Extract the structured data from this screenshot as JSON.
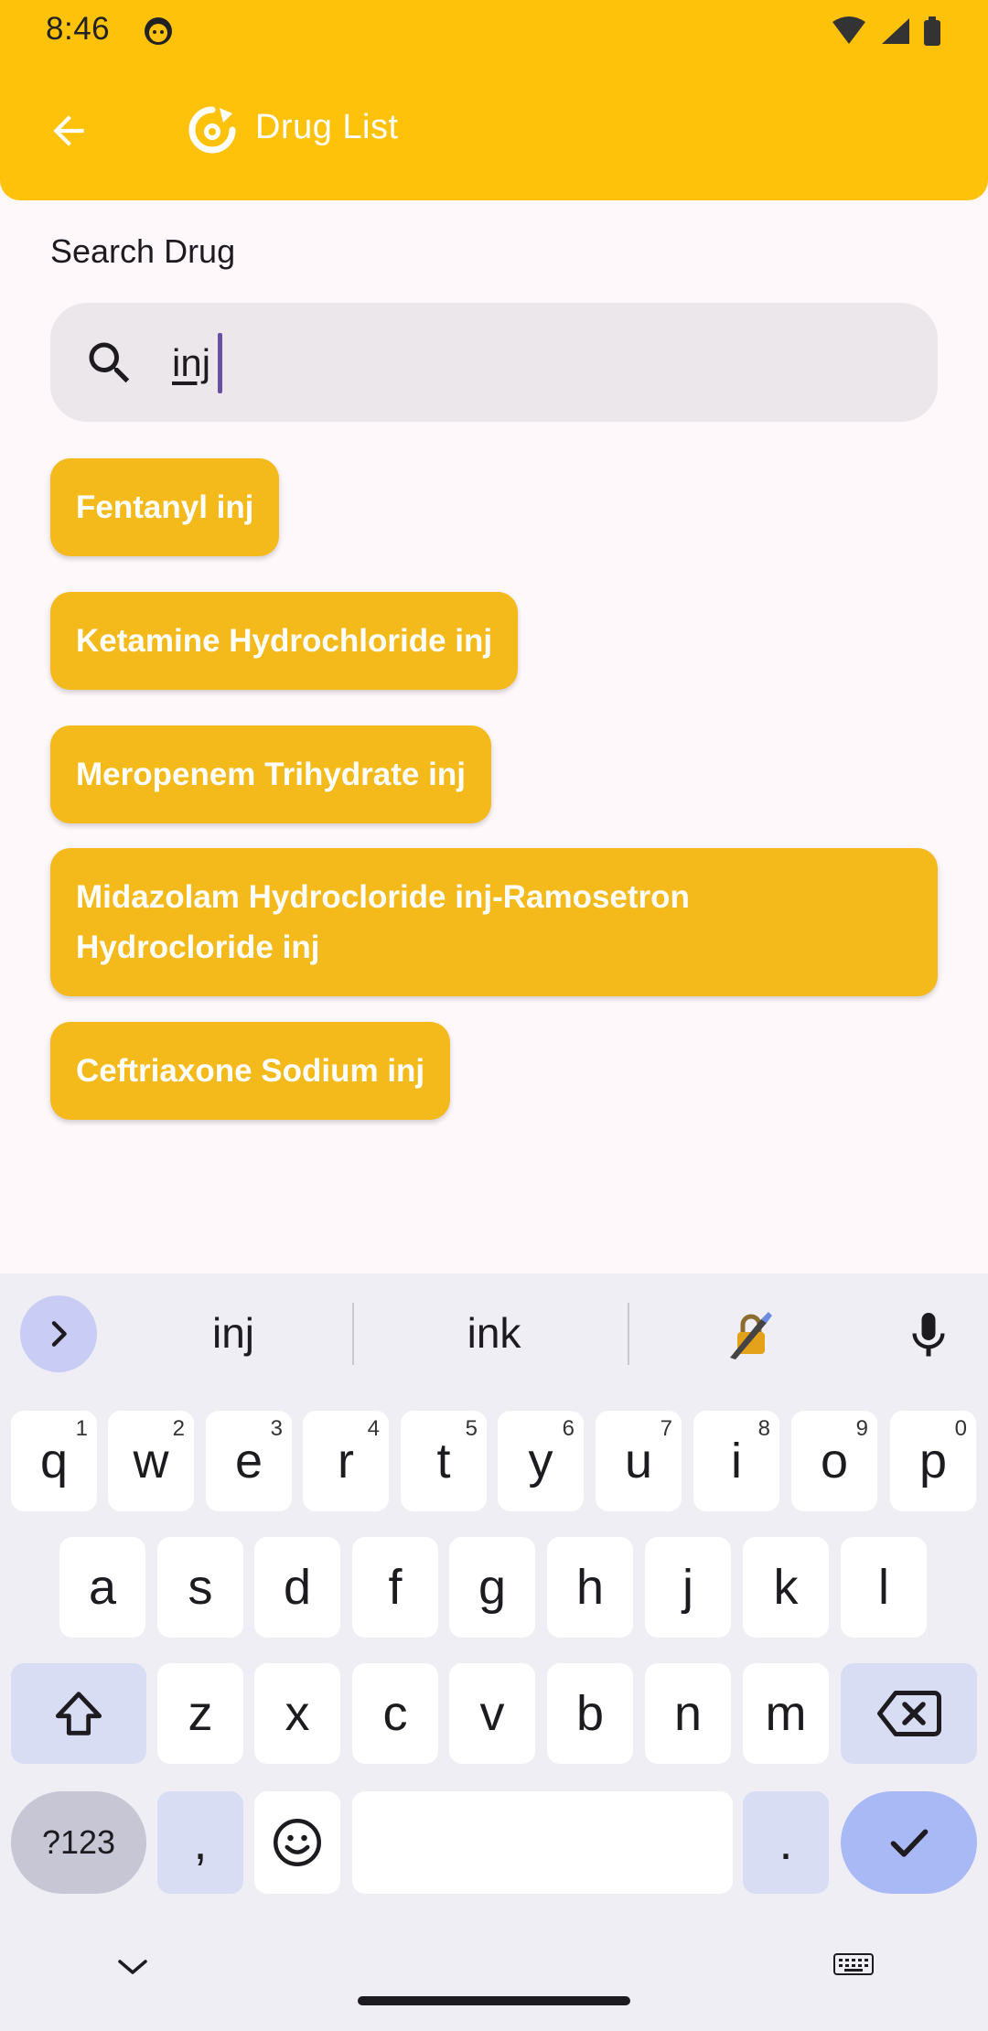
{
  "status_bar": {
    "time": "8:46"
  },
  "header": {
    "title": "Drug List"
  },
  "search": {
    "label": "Search Drug",
    "value": "inj"
  },
  "drugs": [
    "Fentanyl inj",
    "Ketamine Hydrochloride inj",
    "Meropenem Trihydrate inj",
    "Midazolam Hydrocloride inj-Ramosetron Hydrocloride inj",
    "Ceftriaxone Sodium inj"
  ],
  "keyboard": {
    "suggestions": [
      "inj",
      "ink"
    ],
    "row1": [
      {
        "key": "q",
        "hint": "1"
      },
      {
        "key": "w",
        "hint": "2"
      },
      {
        "key": "e",
        "hint": "3"
      },
      {
        "key": "r",
        "hint": "4"
      },
      {
        "key": "t",
        "hint": "5"
      },
      {
        "key": "y",
        "hint": "6"
      },
      {
        "key": "u",
        "hint": "7"
      },
      {
        "key": "i",
        "hint": "8"
      },
      {
        "key": "o",
        "hint": "9"
      },
      {
        "key": "p",
        "hint": "0"
      }
    ],
    "row2": [
      "a",
      "s",
      "d",
      "f",
      "g",
      "h",
      "j",
      "k",
      "l"
    ],
    "row3": [
      "z",
      "x",
      "c",
      "v",
      "b",
      "n",
      "m"
    ],
    "symbols_label": "?123",
    "comma": ",",
    "period": "."
  },
  "colors": {
    "appbar": "#FFC20A",
    "chip": "#F4BA1B",
    "caret": "#6750A4",
    "enter_key": "#A9B9F5"
  }
}
